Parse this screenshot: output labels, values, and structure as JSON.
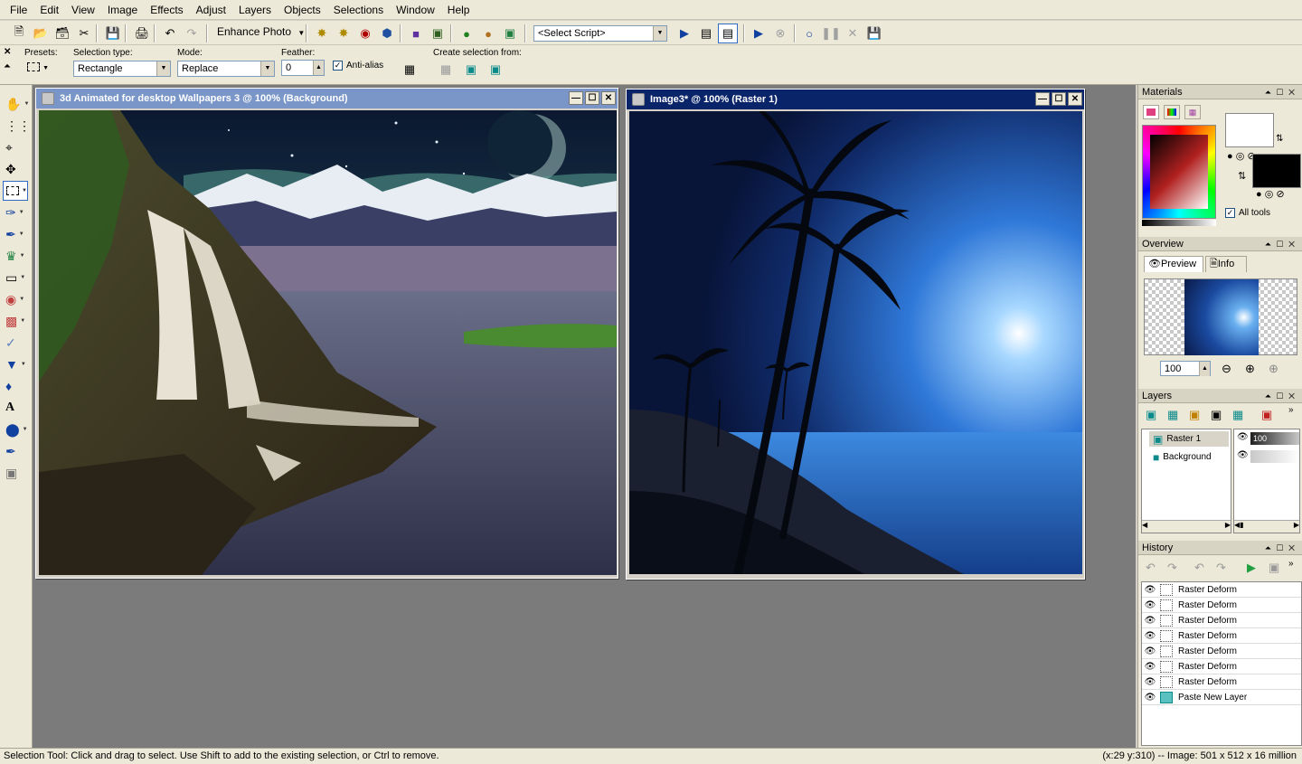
{
  "menu": [
    "File",
    "Edit",
    "View",
    "Image",
    "Effects",
    "Adjust",
    "Layers",
    "Objects",
    "Selections",
    "Window",
    "Help"
  ],
  "toolbar": {
    "enhance_label": "Enhance Photo",
    "script_select": "<Select Script>"
  },
  "options": {
    "presets_label": "Presets:",
    "selection_type_label": "Selection type:",
    "selection_type_value": "Rectangle",
    "mode_label": "Mode:",
    "mode_value": "Replace",
    "feather_label": "Feather:",
    "feather_value": "0",
    "antialias_label": "Anti-alias",
    "create_from_label": "Create selection from:"
  },
  "windows": [
    {
      "title": "3d Animated for desktop Wallpapers 3 @ 100% (Background)",
      "active": false
    },
    {
      "title": "Image3* @ 100% (Raster 1)",
      "active": true
    }
  ],
  "panels": {
    "materials": {
      "title": "Materials",
      "all_tools_label": "All tools"
    },
    "overview": {
      "title": "Overview",
      "tab_preview": "Preview",
      "tab_info": "Info",
      "zoom_value": "100"
    },
    "layers": {
      "title": "Layers",
      "items": [
        {
          "name": "Raster 1",
          "opacity": "100"
        },
        {
          "name": "Background"
        }
      ]
    },
    "history": {
      "title": "History",
      "items": [
        "Raster Deform",
        "Raster Deform",
        "Raster Deform",
        "Raster Deform",
        "Raster Deform",
        "Raster Deform",
        "Raster Deform",
        "Paste New Layer"
      ]
    }
  },
  "status": {
    "left": "Selection Tool: Click and drag to select. Use Shift to add to the existing selection, or Ctrl to remove.",
    "right": "(x:29 y:310) -- Image:  501 x 512 x 16 million"
  },
  "colors": {
    "title_active": "#0a246a",
    "title_inactive": "#7a96c8",
    "workspace": "#7b7b7b"
  }
}
